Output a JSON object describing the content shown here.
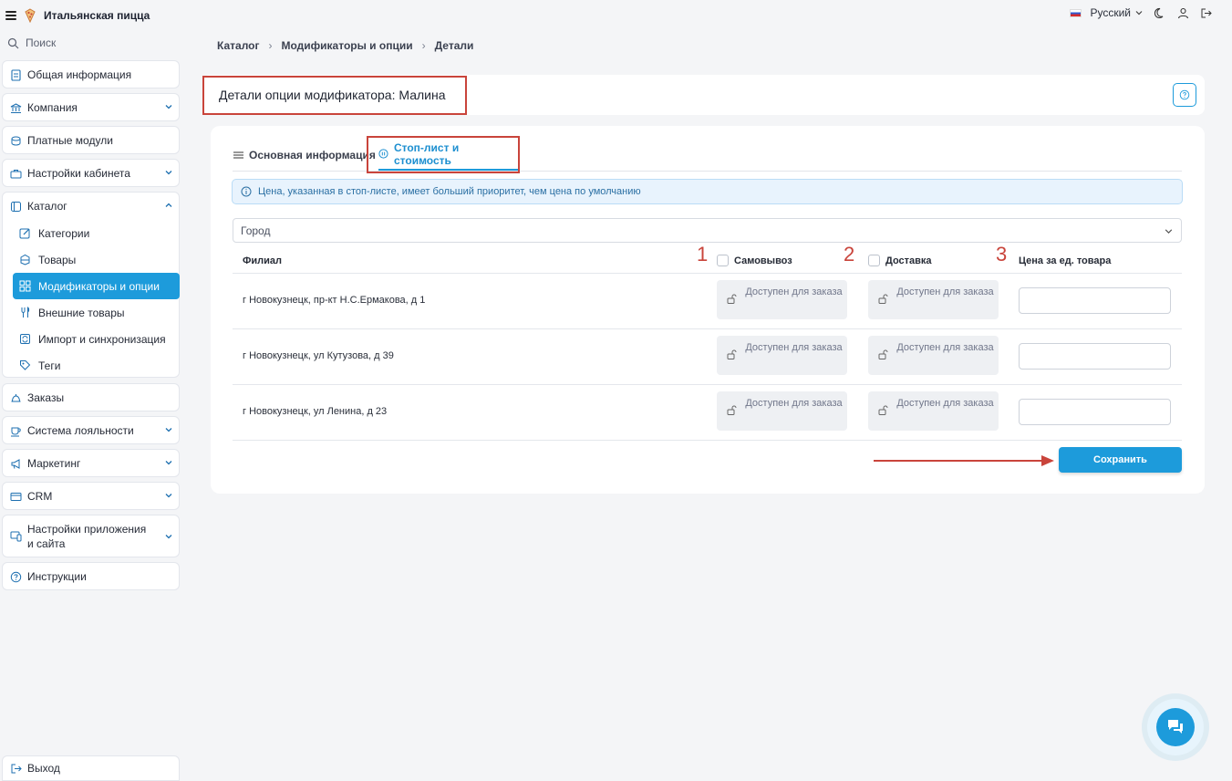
{
  "app": {
    "name": "Итальянская пицца"
  },
  "search": {
    "label": "Поиск"
  },
  "sidebar": {
    "general": "Общая информация",
    "company": "Компания",
    "paid_modules": "Платные модули",
    "cabinet_settings": "Настройки кабинета",
    "catalog": {
      "label": "Каталог",
      "items": [
        {
          "label": "Категории",
          "icon": "edit-icon"
        },
        {
          "label": "Товары",
          "icon": "box-icon"
        },
        {
          "label": "Модификаторы и опции",
          "icon": "grid-icon",
          "active": true
        },
        {
          "label": "Внешние товары",
          "icon": "fork-knife-icon"
        },
        {
          "label": "Импорт и синхронизация",
          "icon": "sync-icon"
        },
        {
          "label": "Теги",
          "icon": "tag-icon"
        }
      ]
    },
    "orders": "Заказы",
    "loyalty": "Система лояльности",
    "marketing": "Маркетинг",
    "crm": "CRM",
    "app_settings": "Настройки приложения и сайта",
    "instructions": "Инструкции",
    "logout": "Выход"
  },
  "topbar": {
    "language": "Русский"
  },
  "breadcrumb": [
    "Каталог",
    "Модификаторы и опции",
    "Детали"
  ],
  "page": {
    "title": "Детали опции модификатора: Малина"
  },
  "tabs": {
    "basic": "Основная информация",
    "stoplist": "Стоп-лист и стоимость"
  },
  "alert": {
    "text": "Цена, указанная в стоп-листе, имеет больший приоритет, чем цена по умолчанию"
  },
  "city_select": {
    "placeholder": "Город"
  },
  "table": {
    "headers": {
      "branch": "Филиал",
      "pickup": "Самовывоз",
      "delivery": "Доставка",
      "price": "Цена за ед. товара"
    },
    "annotations": [
      "1",
      "2",
      "3"
    ],
    "rows": [
      {
        "branch": "г Новокузнецк, пр-кт Н.С.Ермакова, д 1",
        "pickup": "Доступен для заказа",
        "delivery": "Доступен для заказа",
        "price": ""
      },
      {
        "branch": "г Новокузнецк, ул Кутузова, д 39",
        "pickup": "Доступен для заказа",
        "delivery": "Доступен для заказа",
        "price": ""
      },
      {
        "branch": "г Новокузнецк, ул Ленина, д 23",
        "pickup": "Доступен для заказа",
        "delivery": "Доступен для заказа",
        "price": ""
      }
    ]
  },
  "actions": {
    "save": "Сохранить"
  },
  "colors": {
    "accent": "#1d9bdb",
    "annotation": "#c9443b"
  }
}
